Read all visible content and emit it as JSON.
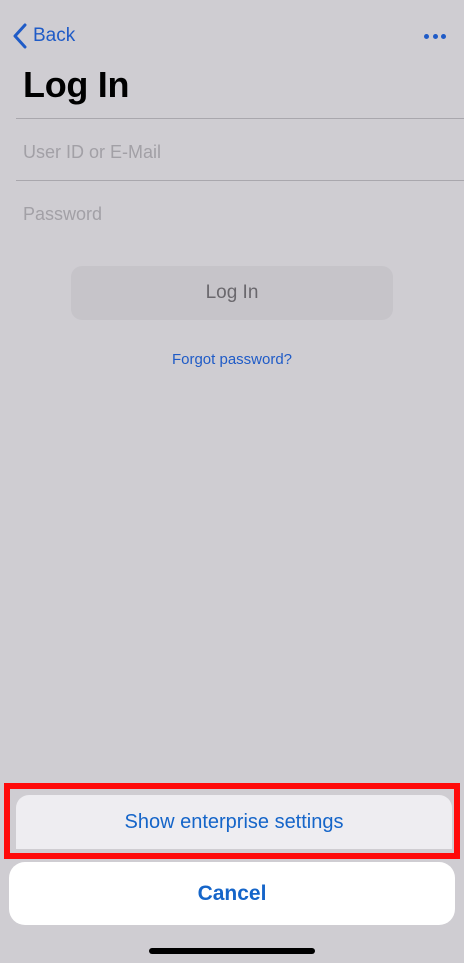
{
  "nav": {
    "back_label": "Back",
    "back_icon": "chevron-left-icon",
    "more_icon": "ellipsis-icon"
  },
  "title": "Log In",
  "form": {
    "user_id_placeholder": "User ID or E-Mail",
    "user_id_value": "",
    "password_placeholder": "Password",
    "password_value": "",
    "login_button_label": "Log In",
    "forgot_password_label": "Forgot password?"
  },
  "action_sheet": {
    "option_label": "Show enterprise settings",
    "cancel_label": "Cancel"
  },
  "colors": {
    "accent": "#1f5bc7",
    "sheet_text": "#1565c9",
    "highlight": "#ff0a0a",
    "background": "#cfcdd2"
  }
}
